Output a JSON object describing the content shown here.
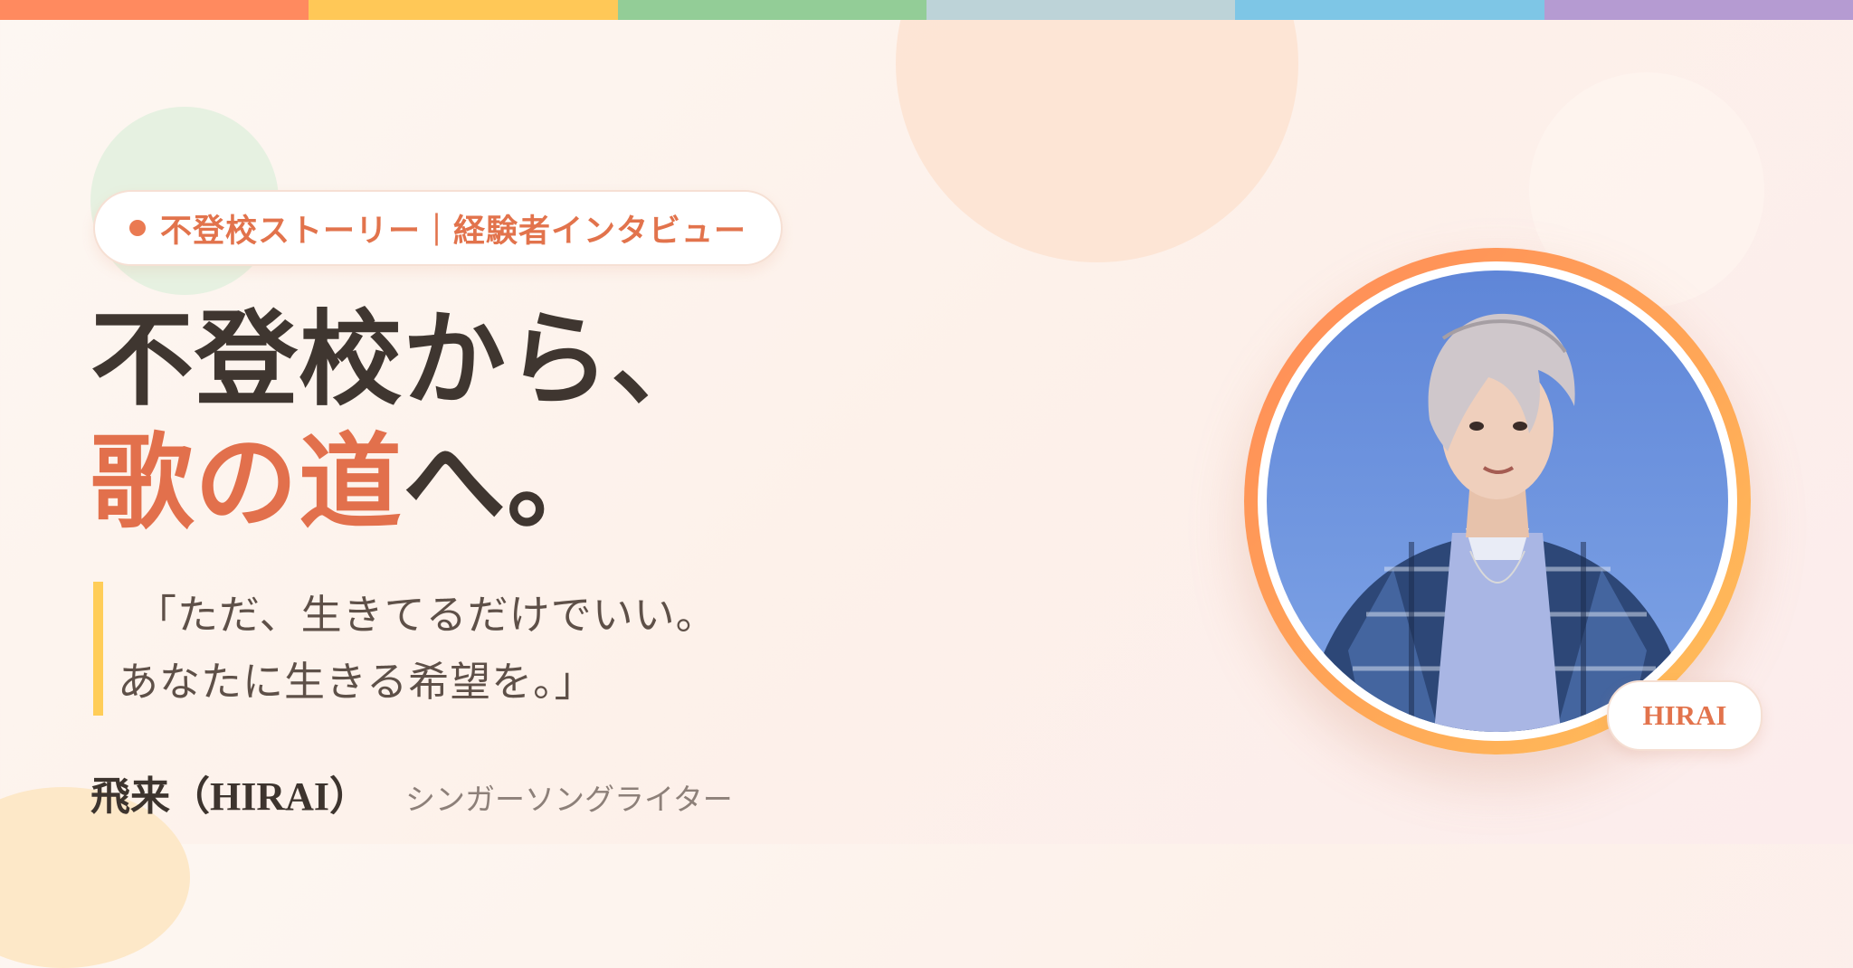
{
  "colors": {
    "accent": "#e2734c",
    "text_dark": "#3f3630",
    "quote_bar": "#ffcd58",
    "rainbow": [
      "#ff8a5f",
      "#ffc857",
      "#93cd97",
      "#bdd3d8",
      "#7ec6e6",
      "#b59bd2"
    ]
  },
  "tag": {
    "text": "不登校ストーリー｜経験者インタビュー"
  },
  "headline": {
    "line1": "不登校から、",
    "line2_accent": "歌の道",
    "line2_rest": "へ。"
  },
  "quote": {
    "line1": "「ただ、生きてるだけでいい。",
    "line2": "あなたに生きる希望を。」"
  },
  "person": {
    "name": "飛来（HIRAI）",
    "role": "シンガーソングライター",
    "badge": "HIRAI"
  },
  "photo": {
    "icon": "portrait-photo"
  }
}
